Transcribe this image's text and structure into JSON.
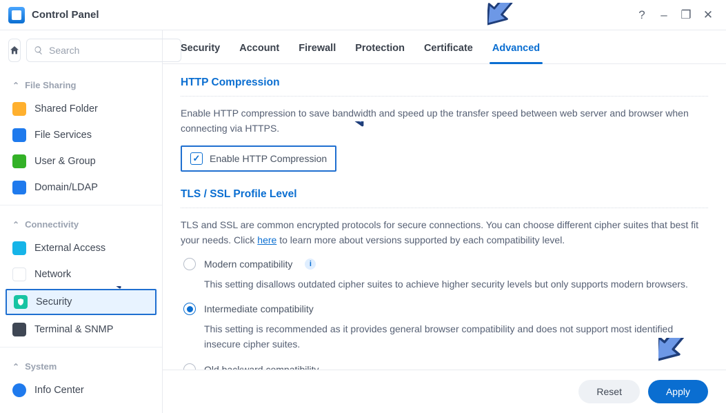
{
  "window": {
    "title": "Control Panel",
    "help_tooltip": "?",
    "minimize": "–",
    "maximize": "❐",
    "close": "✕"
  },
  "search": {
    "placeholder": "Search"
  },
  "sidebar": {
    "groups": [
      {
        "label": "File Sharing",
        "items": [
          {
            "id": "shared-folder",
            "label": "Shared Folder"
          },
          {
            "id": "file-services",
            "label": "File Services"
          },
          {
            "id": "user-group",
            "label": "User & Group"
          },
          {
            "id": "domain-ldap",
            "label": "Domain/LDAP"
          }
        ]
      },
      {
        "label": "Connectivity",
        "items": [
          {
            "id": "external-access",
            "label": "External Access"
          },
          {
            "id": "network",
            "label": "Network"
          },
          {
            "id": "security",
            "label": "Security",
            "active": true
          },
          {
            "id": "terminal-snmp",
            "label": "Terminal & SNMP"
          }
        ]
      },
      {
        "label": "System",
        "items": [
          {
            "id": "info-center",
            "label": "Info Center"
          }
        ]
      }
    ]
  },
  "tabs": [
    {
      "id": "security",
      "label": "Security"
    },
    {
      "id": "account",
      "label": "Account"
    },
    {
      "id": "firewall",
      "label": "Firewall"
    },
    {
      "id": "protection",
      "label": "Protection"
    },
    {
      "id": "certificate",
      "label": "Certificate"
    },
    {
      "id": "advanced",
      "label": "Advanced",
      "active": true
    }
  ],
  "http_compression": {
    "title": "HTTP Compression",
    "description": "Enable HTTP compression to save bandwidth and speed up the transfer speed between web server and browser when connecting via HTTPS.",
    "checkbox_label": "Enable HTTP Compression",
    "checked": true
  },
  "tls": {
    "title": "TLS / SSL Profile Level",
    "description_pre": "TLS and SSL are common encrypted protocols for secure connections. You can choose different cipher suites that best fit your needs. Click ",
    "description_link": "here",
    "description_post": " to learn more about versions supported by each compatibility level.",
    "options": [
      {
        "id": "modern",
        "label": "Modern compatibility",
        "info": true,
        "selected": false,
        "desc": "This setting disallows outdated cipher suites to achieve higher security levels but only supports modern browsers."
      },
      {
        "id": "intermediate",
        "label": "Intermediate compatibility",
        "info": false,
        "selected": true,
        "desc": "This setting is recommended as it provides general browser compatibility and does not support most identified insecure cipher suites."
      },
      {
        "id": "old",
        "label": "Old backward compatibility",
        "info": false,
        "selected": false,
        "desc": ""
      }
    ]
  },
  "footer": {
    "reset": "Reset",
    "apply": "Apply"
  },
  "colors": {
    "accent": "#0a6ed1",
    "arrow_fill": "#6d98e6",
    "arrow_stroke": "#1f3e7a"
  }
}
